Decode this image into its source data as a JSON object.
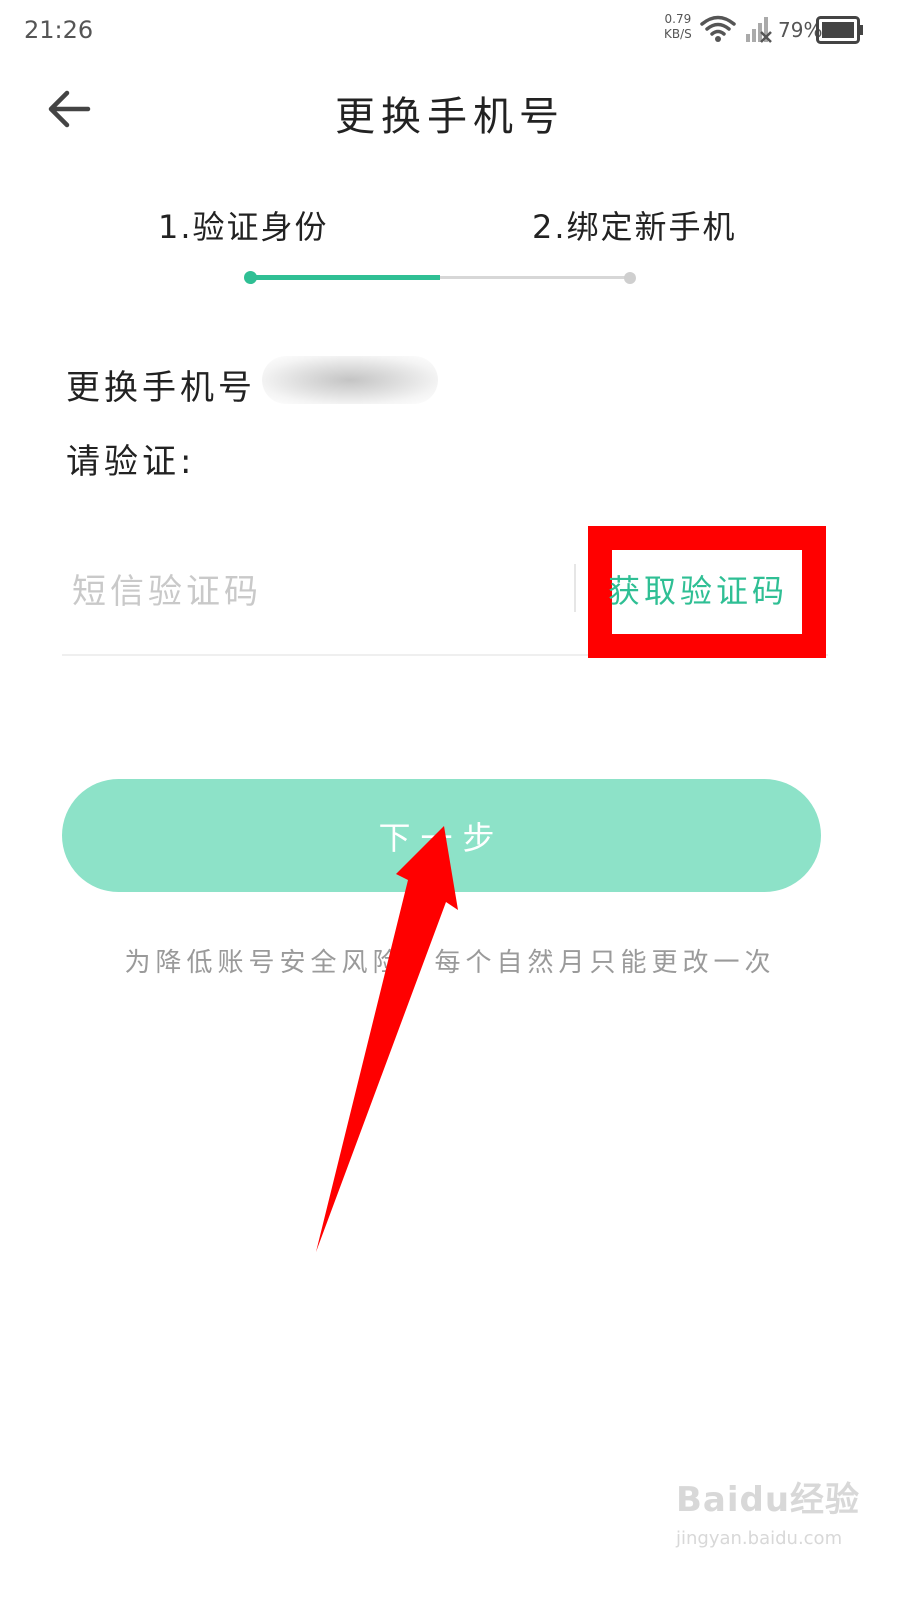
{
  "status_bar": {
    "time": "21:26",
    "net_speed": "0.79",
    "net_speed_unit": "KB/S",
    "battery": "79%"
  },
  "header": {
    "title": "更换手机号",
    "back_icon": "arrow-left-icon"
  },
  "steps": [
    {
      "label": "1.验证身份"
    },
    {
      "label": "2.绑定新手机"
    }
  ],
  "progress": {
    "current_step": 1,
    "total_steps": 2,
    "fill_fraction": 0.5,
    "active_color": "#2fbf94",
    "inactive_color": "#d7d7d7"
  },
  "form": {
    "change_label": "更换手机号",
    "verify_label": "请验证:",
    "code_placeholder": "短信验证码",
    "get_code_label": "获取验证码"
  },
  "next_button": {
    "label": "下一步"
  },
  "hint": "为降低账号安全风险，每个自然月只能更改一次",
  "colors": {
    "accent": "#2fbf94",
    "button_bg": "#8de2c8",
    "annotation": "#ff0000"
  },
  "watermark": {
    "logo": "Baidu经验",
    "url": "jingyan.baidu.com"
  }
}
